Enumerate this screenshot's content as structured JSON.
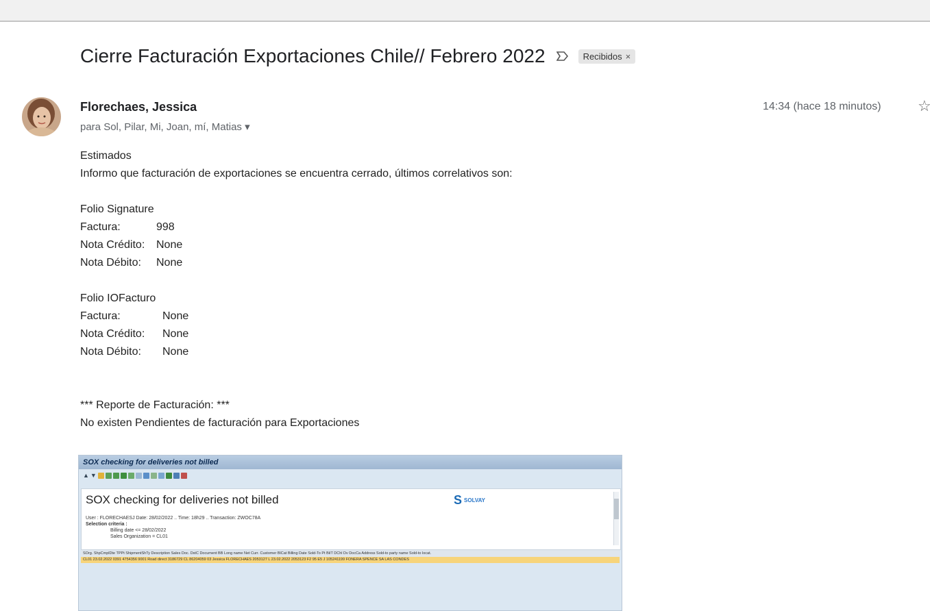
{
  "email": {
    "subject": "Cierre Facturación Exportaciones Chile// Febrero 2022",
    "label": "Recibidos",
    "label_close": "×",
    "importance_icon": "importance-marker-icon",
    "sender_name": "Florechaes, Jessica",
    "recipients": "para Sol, Pilar, Mi, Joan, mí, Matias",
    "recipients_caret": "▾",
    "time": "14:34 (hace 18 minutos)",
    "star_icon": "☆"
  },
  "body": {
    "greeting": "Estimados",
    "intro": "Informo que facturación de exportaciones se encuentra cerrado, últimos correlativos son:",
    "section1_title": "Folio Signature",
    "section1": [
      {
        "label": "Factura:",
        "value": "998"
      },
      {
        "label": "Nota Crédito:",
        "value": "None"
      },
      {
        "label": "Nota Débito:",
        "value": "None"
      }
    ],
    "section2_title": "Folio IOFacturo",
    "section2": [
      {
        "label": "Factura:",
        "value": "None"
      },
      {
        "label": "Nota Crédito:",
        "value": "None"
      },
      {
        "label": "Nota Débito:",
        "value": "None"
      }
    ],
    "report_title": "*** Reporte de Facturación: ***",
    "report_text": "No existen Pendientes de facturación para Exportaciones"
  },
  "sap": {
    "window_title": "SOX checking for deliveries not billed",
    "heading": "SOX checking for deliveries not billed",
    "logo_text": "SOLVAY",
    "info_line1": "User : FLORECHAESJ  Date: 28/02/2022 .. Time: 18h29 .. Transaction: ZWOC78A",
    "info_line2": "Selection criteria :",
    "info_line3": "Billing date <= 28/02/2022",
    "info_line4": "Sales Organization = CL01",
    "grid_header": "SOrg.  ShpCmplDte  TPPt  ShipmentShTy  Description  Sales Doc. DstC Document BB  Long name          Net Curr. Customer  BlCat Billing Date  Sold-To Pt BiIT DChl Dv  DocCa Address      Sold-to party name  Sold-to locat.",
    "grid_row": "CL01   23.02.2022  0391  4754356 9001  Road direct 3186729  CL  86204059 03  Jessica FLORECHAES      2053127  L   23.02.2022  2053123  F2  95  E5  J     105241199 FONERA SPENCE SA LAS CONDES"
  }
}
